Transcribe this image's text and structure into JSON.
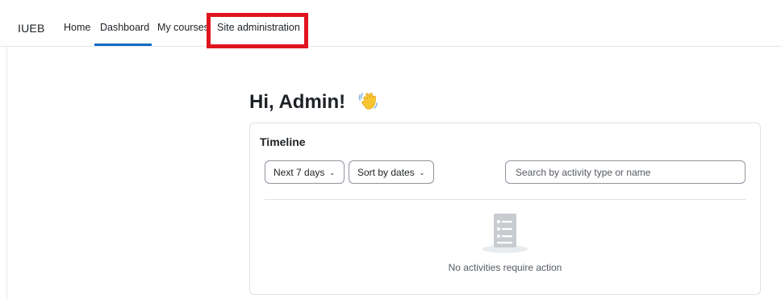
{
  "navbar": {
    "brand": "IUEB",
    "links": [
      {
        "label": "Home"
      },
      {
        "label": "Dashboard",
        "active": true
      },
      {
        "label": "My courses"
      },
      {
        "label": "Site administration",
        "highlighted": true
      }
    ],
    "accent_color": "#0f6cbf",
    "highlight_color": "#e0141e"
  },
  "main": {
    "greeting": "Hi, Admin!",
    "greeting_icon": "waving-hand-icon"
  },
  "timeline": {
    "title": "Timeline",
    "filter_days": "Next 7 days",
    "sort_by": "Sort by dates",
    "search_placeholder": "Search by activity type or name",
    "empty_message": "No activities require action",
    "empty_icon": "activities-list-icon"
  }
}
